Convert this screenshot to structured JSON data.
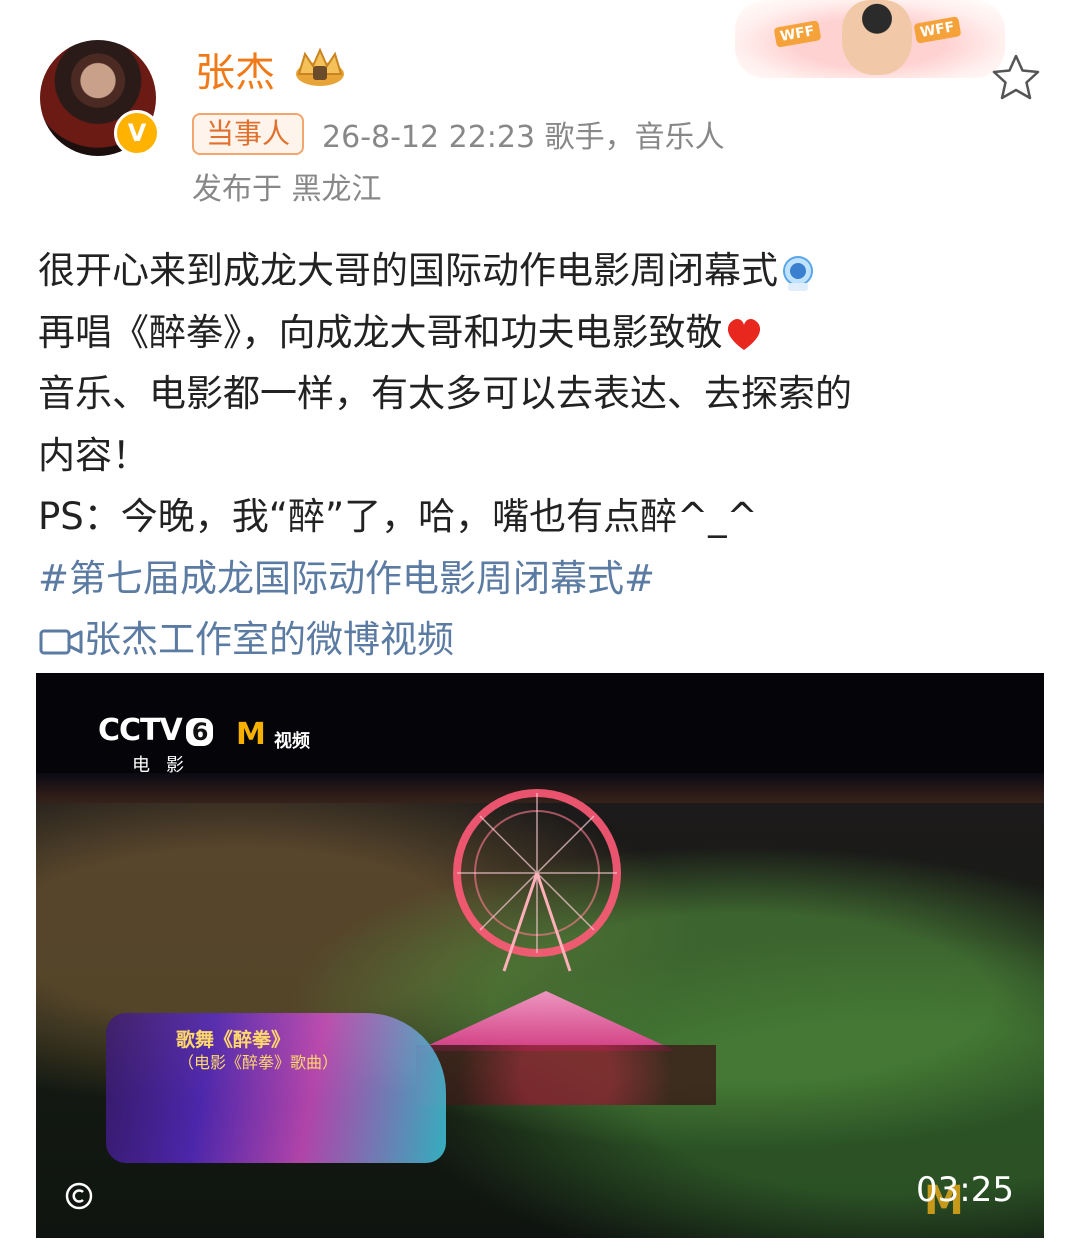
{
  "post": {
    "author": "张杰",
    "role_badge": "当事人",
    "meta": "26-8-12 22:23  歌手，音乐人",
    "location": "发布于 黑龙江",
    "lines": [
      "很开心来到成龙大哥的国际动作电影周闭幕式",
      "再唱《醉拳》，向成龙大哥和功夫电影致敬",
      "音乐、电影都一样，有太多可以去表达、去探索的",
      "内容！",
      "PS：今晚，我“醉”了，哈，嘴也有点醉^_^"
    ],
    "hashtag": "#第七届成龙国际动作电影周闭幕式#",
    "video_link": "张杰工作室的微博视频"
  },
  "banner": {
    "tag": "WFF"
  },
  "video": {
    "channel": "CCTV",
    "channel_num": "6",
    "channel_sub": "电影",
    "partner_text": "视频",
    "song_title": "歌舞《醉拳》",
    "song_sub": "（电影《醉拳》歌曲）",
    "duration": "03:25"
  },
  "icons": {
    "crown": "crown-icon",
    "star": "star-icon",
    "video_camera": "video-camera-icon",
    "verified": "verified-badge-icon"
  },
  "colors": {
    "author_name": "#f07a17",
    "link": "#5b7ba3",
    "badge_bg": "#ffb300"
  }
}
